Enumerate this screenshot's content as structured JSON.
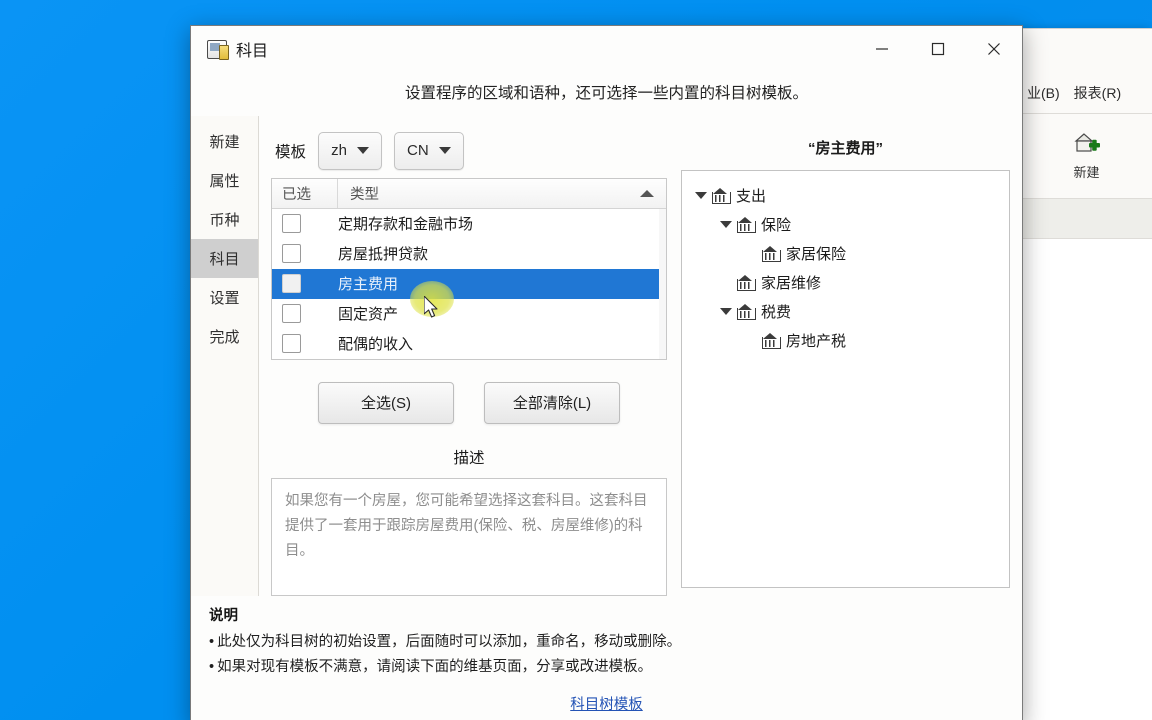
{
  "desktop": {
    "background_color": "#0090f0"
  },
  "background_window": {
    "menu_items": [
      "业(B)",
      "报表(R)"
    ],
    "toolbar": {
      "new_label": "新建",
      "icon": "house-plus-icon"
    }
  },
  "dialog": {
    "title": "科目",
    "title_icon": "account-book-icon",
    "window_controls": {
      "minimize": "minimize-icon",
      "maximize": "maximize-icon",
      "close": "close-icon"
    },
    "header_text": "设置程序的区域和语种，还可选择一些内置的科目树模板。",
    "sidebar": {
      "items": [
        {
          "label": "新建",
          "active": false
        },
        {
          "label": "属性",
          "active": false
        },
        {
          "label": "币种",
          "active": false
        },
        {
          "label": "科目",
          "active": true
        },
        {
          "label": "设置",
          "active": false
        },
        {
          "label": "完成",
          "active": false
        }
      ]
    },
    "template": {
      "label": "模板",
      "language_value": "zh",
      "region_value": "CN"
    },
    "list": {
      "columns": [
        "已选",
        "类型"
      ],
      "sort": "ascending",
      "rows": [
        {
          "label": "定期存款和金融市场",
          "checked": false,
          "selected": false
        },
        {
          "label": "房屋抵押贷款",
          "checked": false,
          "selected": false
        },
        {
          "label": "房主费用",
          "checked": false,
          "selected": true
        },
        {
          "label": "固定资产",
          "checked": false,
          "selected": false
        },
        {
          "label": "配偶的收入",
          "checked": false,
          "selected": false
        }
      ]
    },
    "buttons": {
      "select_all": "全选(S)",
      "clear_all": "全部清除(L)"
    },
    "description": {
      "title": "描述",
      "text": "如果您有一个房屋，您可能希望选择这套科目。这套科目提供了一套用于跟踪房屋费用(保险、税、房屋维修)的科目。"
    },
    "tree_panel": {
      "title": "“房主费用”",
      "nodes": [
        {
          "label": "支出",
          "depth": 0,
          "expanded": true
        },
        {
          "label": "保险",
          "depth": 1,
          "expanded": true
        },
        {
          "label": "家居保险",
          "depth": 2,
          "expanded": null
        },
        {
          "label": "家居维修",
          "depth": 1,
          "expanded": null
        },
        {
          "label": "税费",
          "depth": 1,
          "expanded": true
        },
        {
          "label": "房地产税",
          "depth": 2,
          "expanded": null
        }
      ]
    },
    "notes": {
      "title": "说明",
      "lines": [
        "此处仅为科目树的初始设置，后面随时可以添加，重命名，移动或删除。",
        "如果对现有模板不满意，请阅读下面的维基页面，分享或改进模板。"
      ],
      "link": "科目树模板"
    }
  }
}
